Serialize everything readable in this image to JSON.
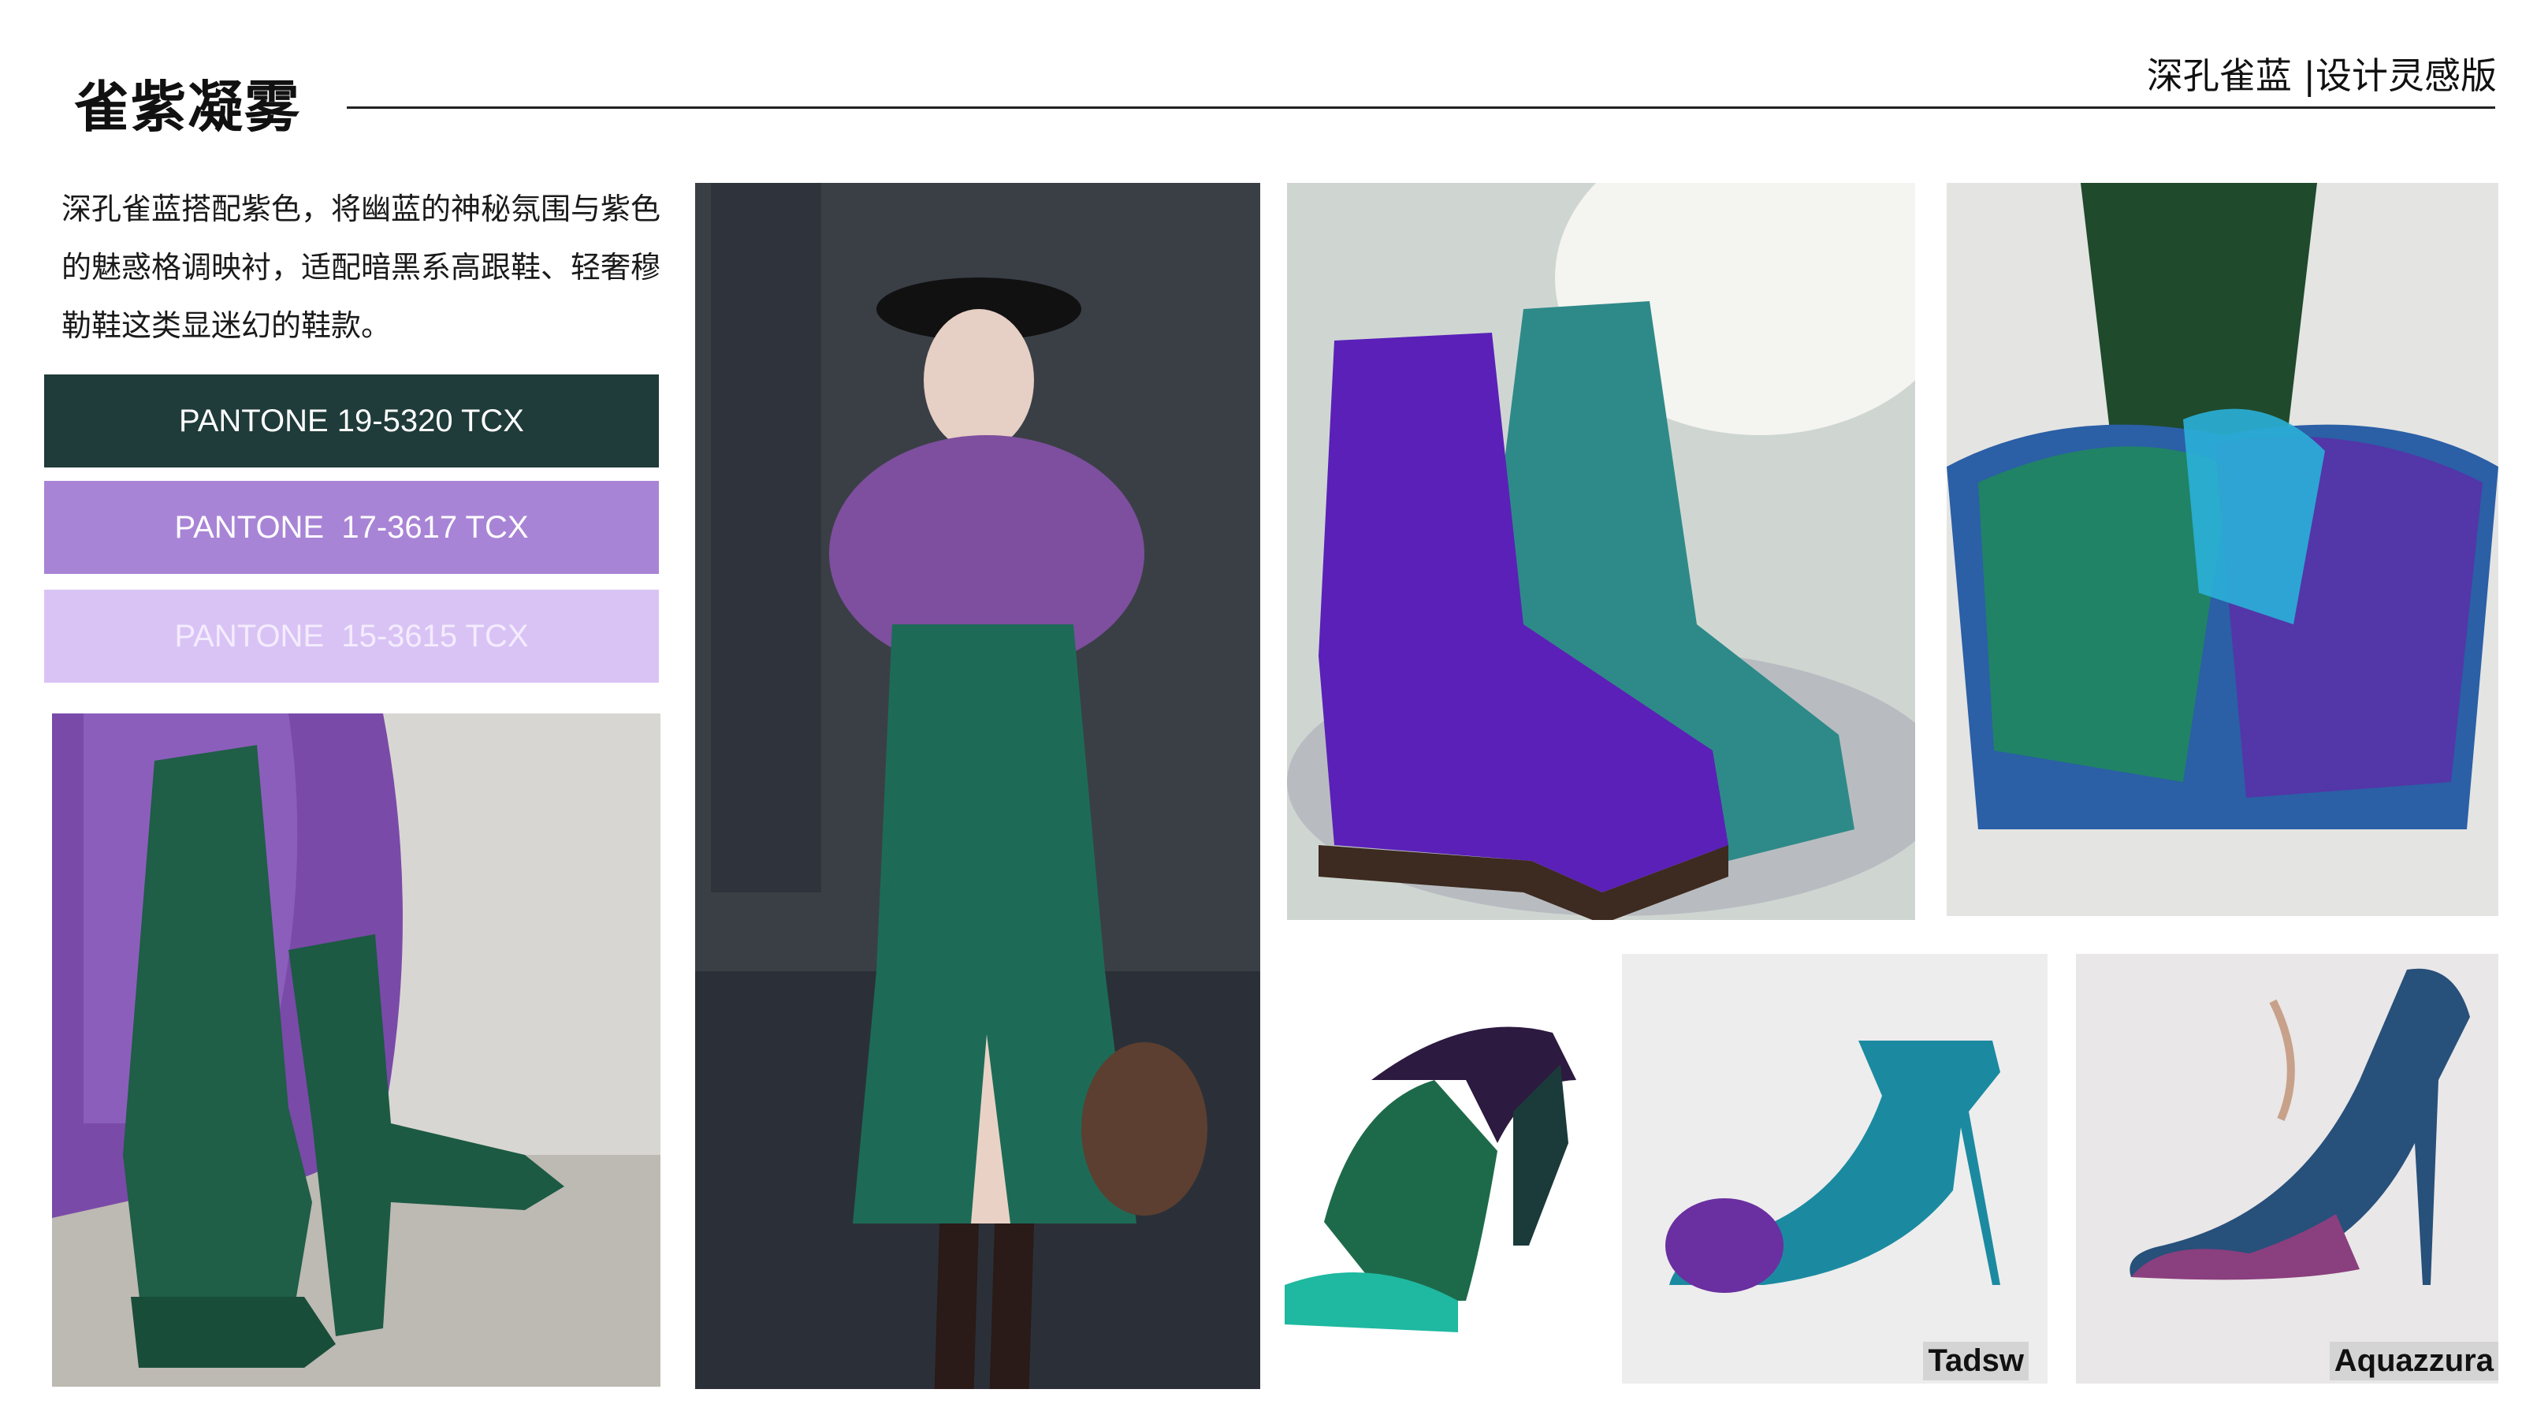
{
  "page": {
    "title": "雀紫凝雾",
    "header_right": "深孔雀蓝 |设计灵感版",
    "description": "深孔雀蓝搭配紫色，将幽蓝的神秘氛围与紫色的魅惑格调映衬，适配暗黑系高跟鞋、轻奢穆勒鞋这类显迷幻的鞋款。"
  },
  "swatches": [
    {
      "label": "PANTONE 19-5320 TCX",
      "color": "#1f3b3a"
    },
    {
      "label": "PANTONE  17-3617 TCX",
      "color": "#a884d6"
    },
    {
      "label": "PANTONE  15-3615 TCX",
      "color": "#d9c3f5"
    }
  ],
  "brands": {
    "pump_teal": "Tadsw",
    "pump_velvet": "Aquazzura"
  }
}
